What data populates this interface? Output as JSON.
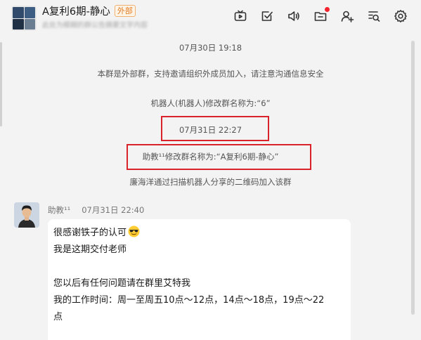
{
  "header": {
    "title": "A复利6期-静心",
    "tag": "外部",
    "subtitle": "此处为模糊的群公告摘要文字内容"
  },
  "messages": {
    "system": [
      "07月30日 19:18",
      "本群是外部群，支持邀请组织外成员加入，请注意沟通信息安全",
      "机器人(机器人)修改群名称为:“6”",
      "07月31日 22:27",
      "助教¹¹修改群名称为:“A复利6期-静心”",
      "廉海洋通过扫描机器人分享的二维码加入该群"
    ],
    "chat": {
      "sender": "助教¹¹",
      "time": "07月31日 22:40",
      "lines": [
        "很感谢铁子的认可",
        "我是这期交付老师",
        "",
        "您以后有任何问题请在群里艾特我",
        "我的工作时间：周一至周五10点～12点，14点～18点，19点～22",
        "点"
      ]
    }
  },
  "colors": {
    "highlight": "#d9222a",
    "tag_text": "#e07a1f",
    "notify_dot": "#f5222d"
  },
  "icons": [
    "tv-icon",
    "task-check-icon",
    "speaker-icon",
    "folder-icon",
    "add-member-icon",
    "search-history-icon",
    "gear-icon",
    "sunglasses-emoji-icon"
  ]
}
